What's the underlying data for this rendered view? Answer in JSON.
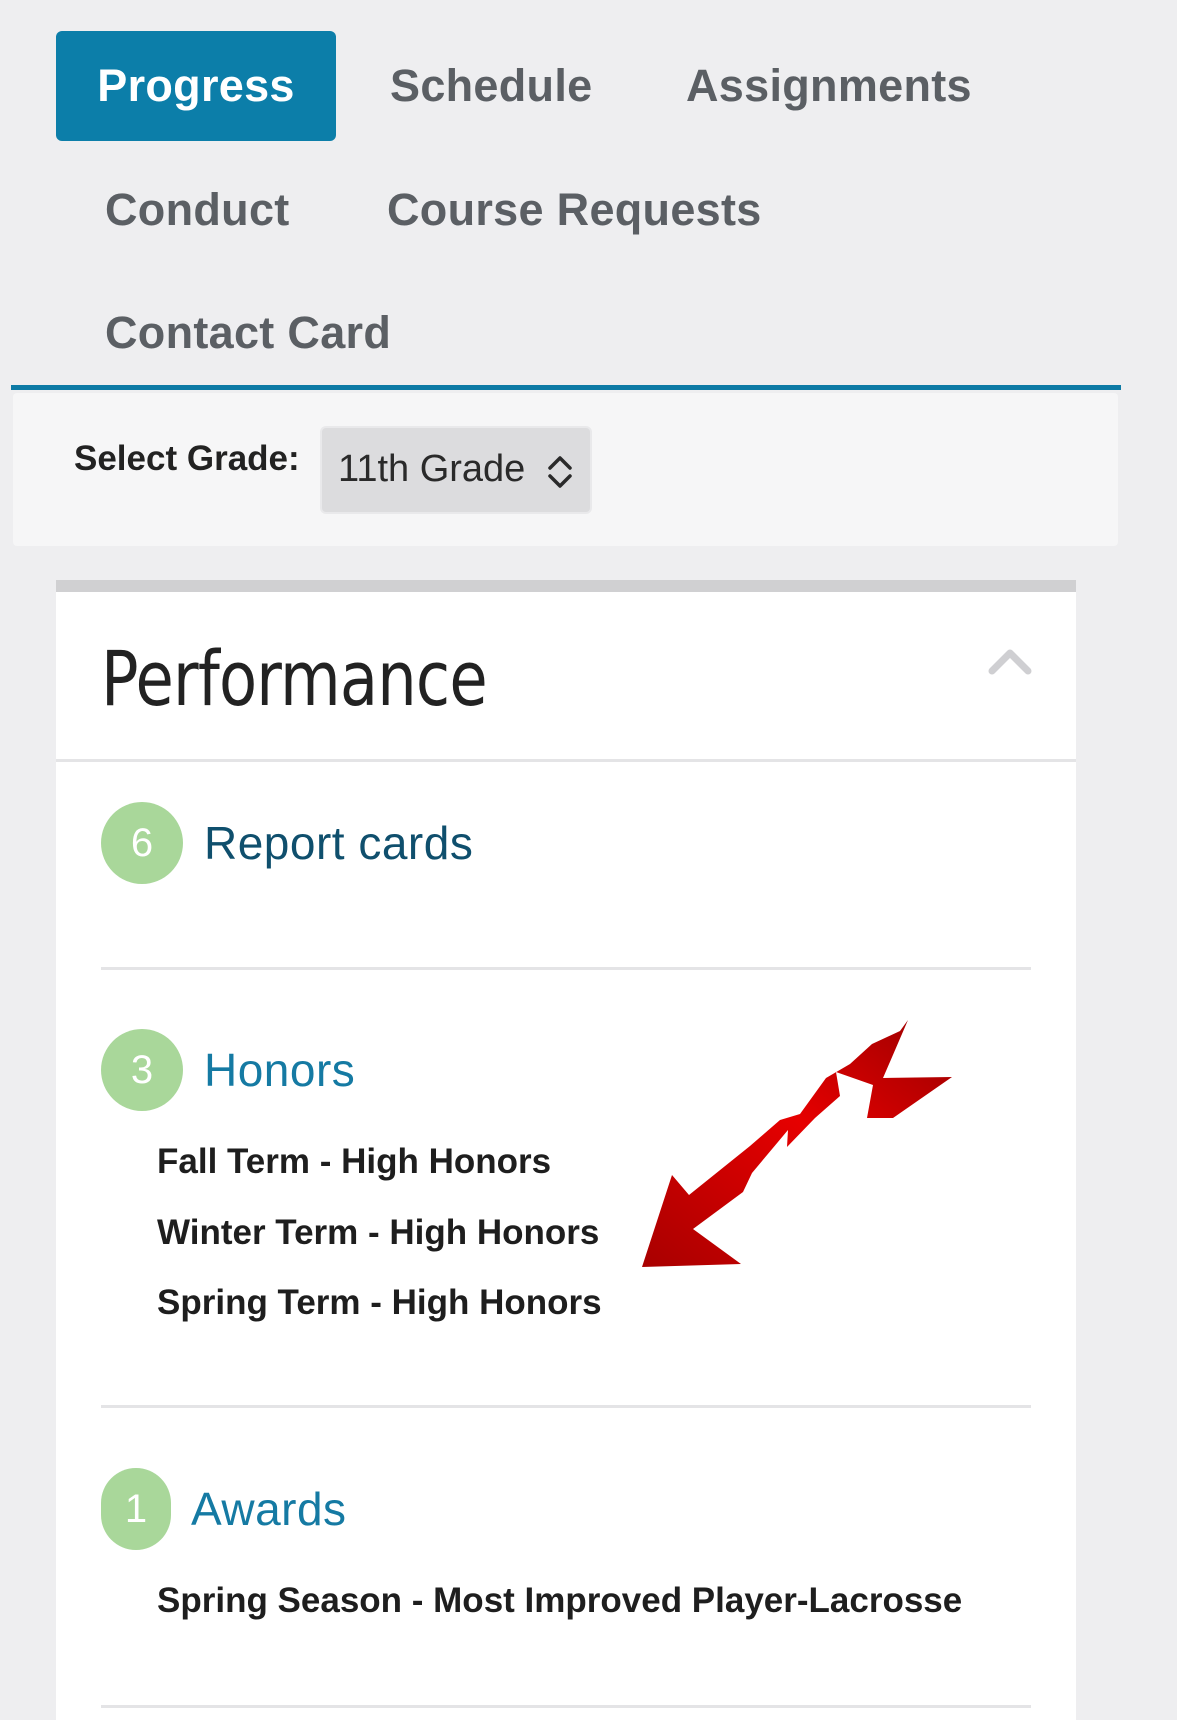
{
  "tabs": [
    {
      "label": "Progress",
      "active": true
    },
    {
      "label": "Schedule",
      "active": false
    },
    {
      "label": "Assignments",
      "active": false
    },
    {
      "label": "Conduct",
      "active": false
    },
    {
      "label": "Course Requests",
      "active": false
    },
    {
      "label": "Contact Card",
      "active": false
    }
  ],
  "grade_filter": {
    "label": "Select Grade:",
    "selected": "11th Grade"
  },
  "performance": {
    "title": "Performance",
    "sections": [
      {
        "count": "6",
        "label": "Report cards",
        "entries": []
      },
      {
        "count": "3",
        "label": "Honors",
        "entries": [
          "Fall Term - High Honors",
          "Winter Term - High Honors",
          "Spring Term - High Honors"
        ]
      },
      {
        "count": "1",
        "label": "Awards",
        "entries": [
          "Spring Season - Most Improved Player-Lacrosse"
        ]
      }
    ]
  },
  "colors": {
    "accent": "#0c7ea9",
    "badge": "#a9d79a",
    "link": "#157aa3",
    "arrow": "#d10000"
  },
  "icons": {
    "grade_select": "up-down-chevron-icon",
    "collapse": "chevron-up-icon",
    "annotation": "red-arrow-icon"
  }
}
